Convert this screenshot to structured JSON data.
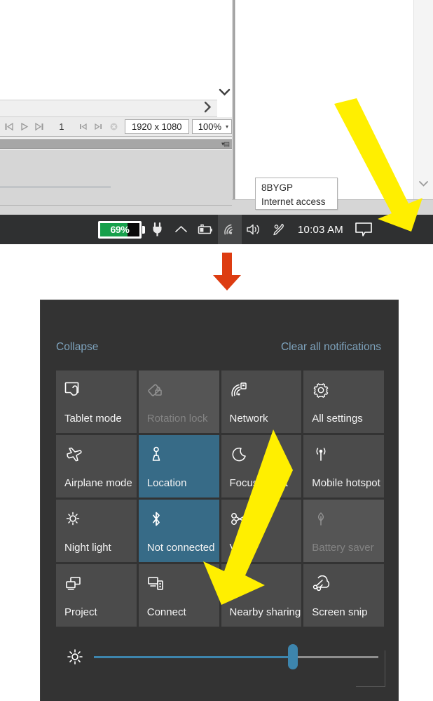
{
  "left_window": {
    "toolbar": {
      "first_frame_icon": "skip-to-start-icon",
      "play_icon": "play-icon",
      "last_frame_icon": "skip-to-end-icon",
      "frame_number": "1",
      "step_back_icon": "step-back-icon",
      "step_forward_icon": "step-forward-icon",
      "clear_icon": "clear-icon",
      "resolution": "1920 x 1080",
      "zoom": "100%",
      "zoom_caret": "▾"
    },
    "scroll_down_icon": "chevron-down-icon",
    "scroll_right_icon": "chevron-right-icon",
    "panel_menu_icon": "panel-menu-icon"
  },
  "right_window": {
    "scroll_down_icon": "chevron-down-icon",
    "status_icon": "tray-small-icon"
  },
  "tooltip": {
    "line1": "8BYGP",
    "line2": "Internet access"
  },
  "taskbar": {
    "battery_percent": "69%",
    "battery_fill_ratio": 69,
    "items": [
      {
        "name": "battery-percent-indicator",
        "label": "69%"
      },
      {
        "name": "power-plug-icon",
        "label": ""
      },
      {
        "name": "show-hidden-icons-chevron",
        "label": ""
      },
      {
        "name": "battery-icon",
        "label": ""
      },
      {
        "name": "network-wifi-icon",
        "label": ""
      },
      {
        "name": "volume-icon",
        "label": ""
      },
      {
        "name": "pen-workspace-icon",
        "label": ""
      }
    ],
    "clock": "10:03 AM",
    "action_center_icon": "notification-chat-icon",
    "background_color": "#2f3031",
    "highlight_color": "#474849"
  },
  "annotations": {
    "red_arrow_color": "#dd3c11",
    "yellow_arrow_color": "#ffef00"
  },
  "action_center": {
    "collapse_label": "Collapse",
    "clear_all_label": "Clear all notifications",
    "link_color": "#7ea3bd",
    "panel_color": "#333333",
    "tile_color": "#4b4b4b",
    "tile_active_color": "#376b87",
    "tile_disabled_color": "#555555",
    "tiles": [
      {
        "label": "Tablet mode",
        "icon": "tablet-mode-icon",
        "state": "normal"
      },
      {
        "label": "Rotation lock",
        "icon": "rotation-lock-icon",
        "state": "disabled"
      },
      {
        "label": "Network",
        "icon": "network-wifi-icon",
        "state": "normal"
      },
      {
        "label": "All settings",
        "icon": "gear-icon",
        "state": "normal"
      },
      {
        "label": "Airplane mode",
        "icon": "airplane-icon",
        "state": "normal"
      },
      {
        "label": "Location",
        "icon": "location-icon",
        "state": "active"
      },
      {
        "label": "Focus assist",
        "icon": "focus-assist-icon",
        "state": "normal"
      },
      {
        "label": "Mobile hotspot",
        "icon": "hotspot-icon",
        "state": "normal"
      },
      {
        "label": "Night light",
        "icon": "night-light-icon",
        "state": "normal"
      },
      {
        "label": "Not connected",
        "icon": "bluetooth-icon",
        "state": "active"
      },
      {
        "label": "VPN",
        "icon": "vpn-icon",
        "state": "normal"
      },
      {
        "label": "Battery saver",
        "icon": "battery-saver-icon",
        "state": "disabled"
      },
      {
        "label": "Project",
        "icon": "project-icon",
        "state": "normal"
      },
      {
        "label": "Connect",
        "icon": "connect-icon",
        "state": "normal"
      },
      {
        "label": "Nearby sharing",
        "icon": "nearby-sharing-icon",
        "state": "normal"
      },
      {
        "label": "Screen snip",
        "icon": "screen-snip-icon",
        "state": "normal"
      }
    ],
    "brightness": {
      "icon": "brightness-sun-icon",
      "value_percent": 70,
      "fill_color": "#3d85ad",
      "track_color": "#8e8e8e"
    }
  }
}
